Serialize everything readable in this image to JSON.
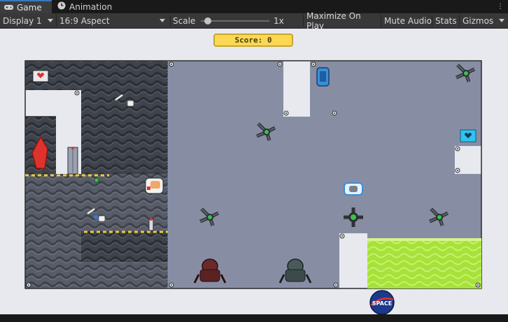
{
  "tabs": [
    {
      "label": "Game",
      "icon": "gamepad-icon",
      "active": true
    },
    {
      "label": "Animation",
      "icon": "clock-icon",
      "active": false
    }
  ],
  "toolbar": {
    "display": "Display 1",
    "aspect": "16:9 Aspect",
    "scale_label": "Scale",
    "scale_value": "1x",
    "scale_fraction": 0.05,
    "maximize": "Maximize On Play",
    "mute": "Mute Audio",
    "stats": "Stats",
    "gizmos": "Gizmos"
  },
  "game": {
    "score_text": "Score: 0",
    "logo_text": "SPACE",
    "colors": {
      "wall_dark": "#3f434b",
      "floor": "#878ea4",
      "acid": "#a6e23a",
      "score_bg": "#fbd854"
    }
  }
}
